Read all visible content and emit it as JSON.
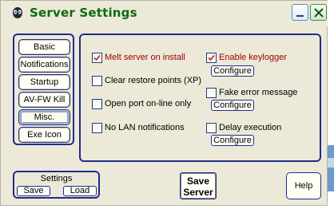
{
  "window": {
    "title": "Server Settings"
  },
  "sidebar": {
    "items": [
      {
        "label": "Basic"
      },
      {
        "label": "Notifications"
      },
      {
        "label": "Startup"
      },
      {
        "label": "AV-FW Kill"
      },
      {
        "label": "Misc."
      },
      {
        "label": "Exe Icon"
      }
    ],
    "active": "Misc."
  },
  "options": {
    "melt_server": {
      "label": "Melt server on install",
      "checked": true
    },
    "clear_restore": {
      "label": "Clear restore points (XP)",
      "checked": false
    },
    "open_port": {
      "label": "Open port on-line only",
      "checked": false
    },
    "no_lan": {
      "label": "No LAN notifications",
      "checked": false
    },
    "enable_keylogger": {
      "label": "Enable keylogger",
      "checked": true,
      "button": "Configure"
    },
    "fake_error": {
      "label": "Fake error message",
      "checked": false,
      "button": "Configure"
    },
    "delay_execution": {
      "label": "Delay execution",
      "checked": false,
      "button": "Configure"
    }
  },
  "settings_group": {
    "title": "Settings",
    "save_label": "Save",
    "load_label": "Load"
  },
  "save_server": {
    "line1": "Save",
    "line2": "Server"
  },
  "help": {
    "label": "Help"
  },
  "colors": {
    "title_text": "#0b6a14",
    "group_border": "#1f2d8a",
    "accent_label": "#9b0000",
    "window_bg": "#ece9d8"
  }
}
